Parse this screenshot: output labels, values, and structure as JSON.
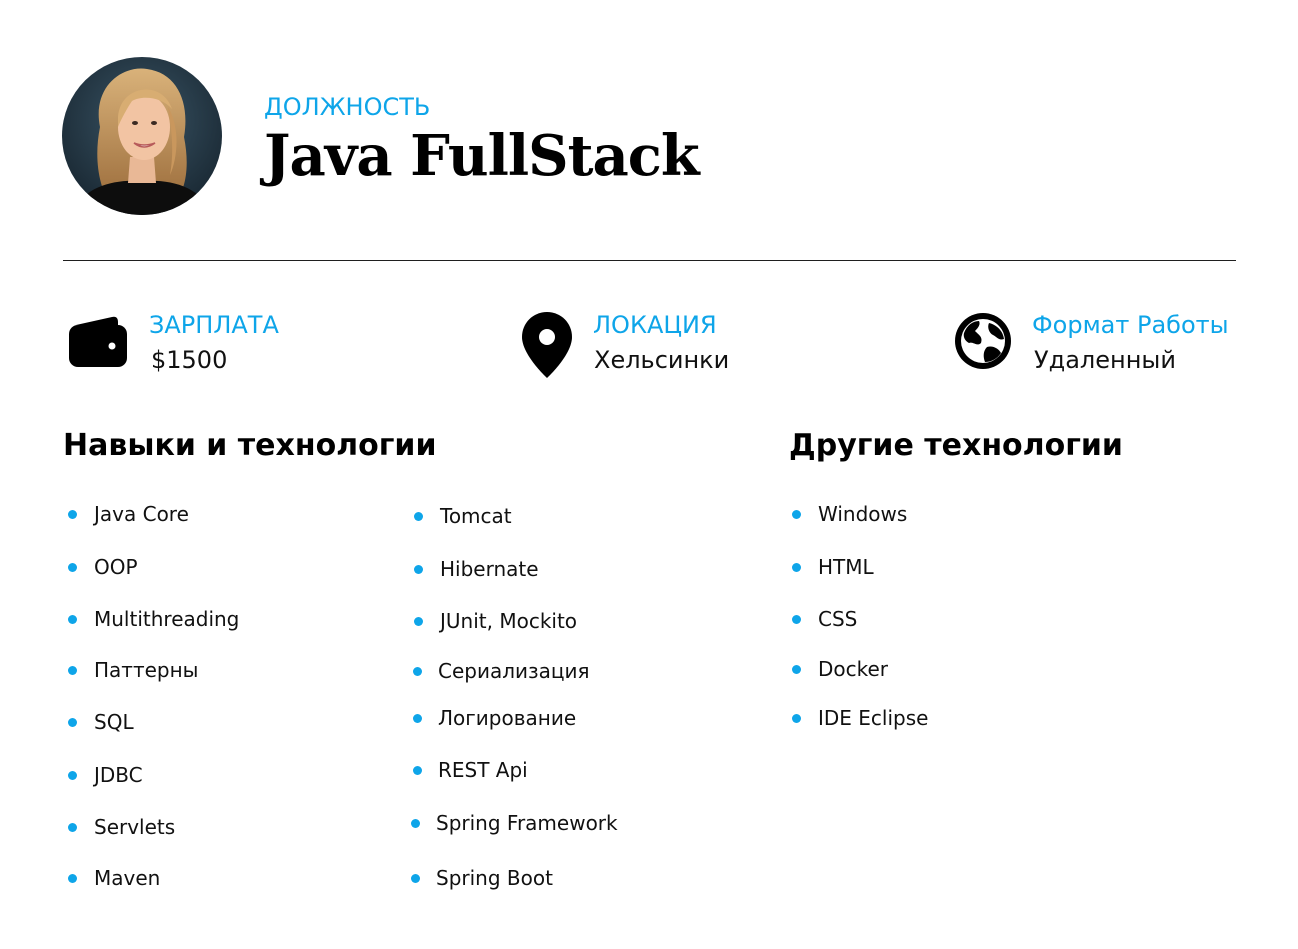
{
  "header": {
    "eyebrow": "ДОЛЖНОСТЬ",
    "title": "Java FullStack"
  },
  "info": {
    "salary": {
      "label": "ЗАРПЛАТА",
      "value": "$1500",
      "icon": "wallet-icon"
    },
    "location": {
      "label": "ЛОКАЦИЯ",
      "value": "Хельсинки",
      "icon": "location-pin-icon"
    },
    "format": {
      "label": "Формат Работы",
      "value": "Удаленный",
      "icon": "globe-icon"
    }
  },
  "skills": {
    "title": "Навыки и технологии",
    "col1": [
      "Java Core",
      "OOP",
      "Multithreading",
      "Паттерны",
      "SQL",
      "JDBC",
      "Servlets",
      "Maven"
    ],
    "col2": [
      "Tomcat",
      "Hibernate",
      "JUnit, Mockito",
      "Сериализация",
      "Логирование",
      "REST Api",
      "Spring Framework",
      "Spring Boot"
    ]
  },
  "other": {
    "title": "Другие технологии",
    "items": [
      "Windows",
      "HTML",
      "CSS",
      "Docker",
      "IDE Eclipse"
    ]
  },
  "colors": {
    "accent": "#0ea5e9",
    "text": "#000000",
    "background": "#ffffff"
  }
}
